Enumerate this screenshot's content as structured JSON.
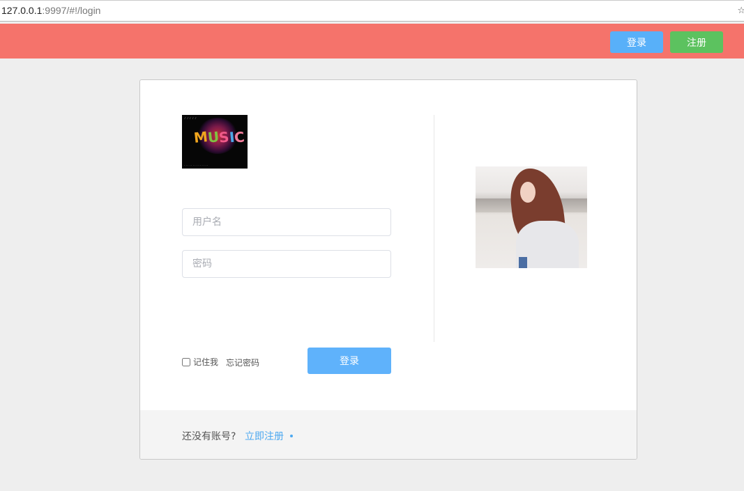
{
  "browser": {
    "url_host": "127.0.0.1",
    "url_rest": ":9997/#!/login",
    "bookmark_icon": "star-icon"
  },
  "nav": {
    "login_label": "登录",
    "register_label": "注册"
  },
  "form": {
    "logo_text": "MUSIC",
    "username_placeholder": "用户名",
    "password_placeholder": "密码",
    "remember_label": "记住我",
    "forgot_label": "忘记密码",
    "submit_label": "登录"
  },
  "footer": {
    "prompt": "还没有账号?",
    "register_link": "立即注册"
  },
  "colors": {
    "nav_bg": "#f5736b",
    "login_btn": "#58b0f9",
    "register_btn": "#5cc25f",
    "link": "#4ca8f0"
  }
}
